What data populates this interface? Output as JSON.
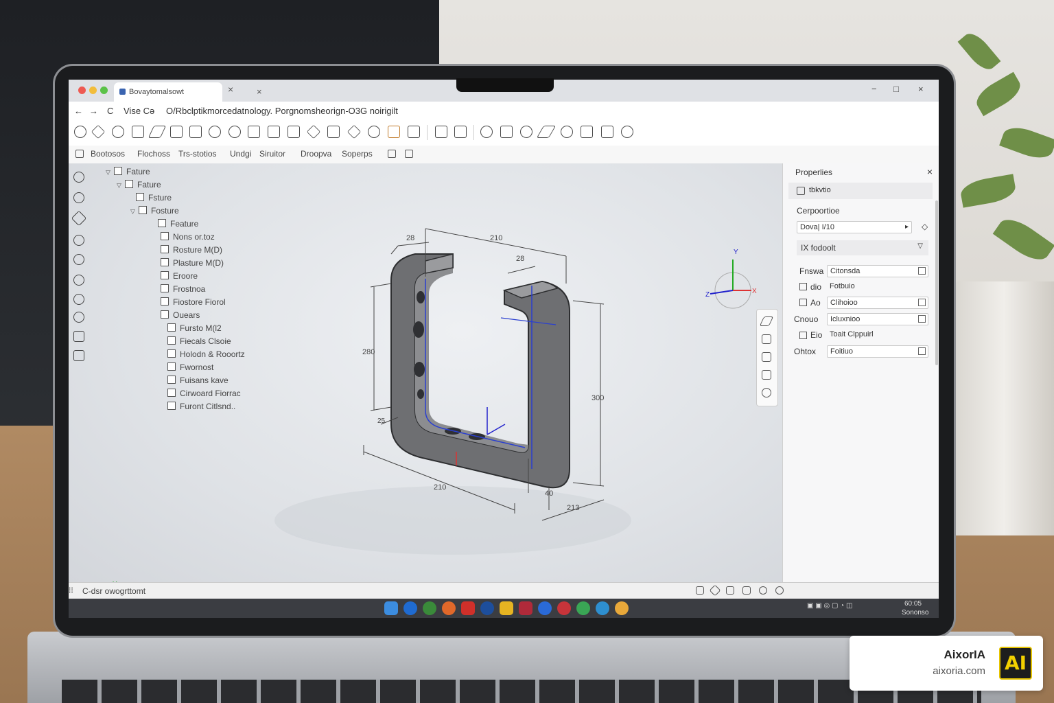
{
  "browser": {
    "tab_title": "Bovaytomalsowt",
    "tab_close": "×",
    "new_tab": "×",
    "nav_back": "←",
    "nav_forward": "→",
    "nav_reload": "C",
    "address_part1": "Vise  Cə",
    "address_url": "O/Rbclptikmorcedatnology.  Porgnomsheorign-O3G noirigilt",
    "win_min": "−",
    "win_max": "□",
    "win_close": "×"
  },
  "menubar": [
    "Bootosos",
    "Flochoss",
    "Trs-stotios",
    "Undgi",
    "Siruitor",
    "Droopva",
    "Soperps"
  ],
  "tree": [
    {
      "label": "Fature",
      "indent": 0,
      "arrow": "▽"
    },
    {
      "label": "Fature",
      "indent": 1,
      "arrow": "▽"
    },
    {
      "label": "Fsture",
      "indent": 2,
      "arrow": ""
    },
    {
      "label": "Fosture",
      "indent": 1,
      "arrow": "▽"
    },
    {
      "label": "Feature",
      "indent": 3,
      "arrow": ""
    },
    {
      "label": "Nons or.toz",
      "indent": 4,
      "arrow": ""
    },
    {
      "label": "Rosture M(D)",
      "indent": 4,
      "arrow": ""
    },
    {
      "label": "Plasture M(D)",
      "indent": 4,
      "arrow": ""
    },
    {
      "label": "Eroore",
      "indent": 4,
      "arrow": ""
    },
    {
      "label": "Frostnoa",
      "indent": 4,
      "arrow": ""
    },
    {
      "label": "Fiostore Fiorol",
      "indent": 4,
      "arrow": ""
    },
    {
      "label": "Ouears",
      "indent": 4,
      "arrow": ""
    },
    {
      "label": "Fursto M(l2",
      "indent": 5,
      "arrow": ""
    },
    {
      "label": "Fiecals Clsoie",
      "indent": 5,
      "arrow": ""
    },
    {
      "label": "Holodn & Rooortz",
      "indent": 5,
      "arrow": ""
    },
    {
      "label": "Fwornost",
      "indent": 5,
      "arrow": ""
    },
    {
      "label": "Fuisans kave",
      "indent": 5,
      "arrow": ""
    },
    {
      "label": "Cirwoard Fiorrac",
      "indent": 5,
      "arrow": ""
    },
    {
      "label": "Furont Citlsnd..",
      "indent": 5,
      "arrow": ""
    }
  ],
  "dimensions": {
    "d_top_left": "28",
    "d_top_mid": "210",
    "d_top_right": "28",
    "d_left": "280",
    "d_right": "300",
    "d_bottom": "210",
    "d_bottom_small": "40",
    "d_depth": "213",
    "d_corner": "25"
  },
  "triad": {
    "y": "Y",
    "x": "X",
    "z": "Z"
  },
  "axis_small": {
    "y": "Y",
    "x": "X",
    "z": "Z"
  },
  "properties": {
    "title": "Properlies",
    "close": "×",
    "section1": "tbkvtio",
    "section2": "Cerpoortioe",
    "select1": "Dova| I/10",
    "group": "IX  fodoolt",
    "rows": [
      {
        "label": "Fnswa",
        "value": "Citonsda"
      },
      {
        "label": "dio",
        "value": "Fotbuio"
      },
      {
        "label": "Ao",
        "value": "Clihoioo"
      },
      {
        "label": "Cnouo",
        "value": "Icluxnioo"
      },
      {
        "label": "Eio",
        "value": "Toait Clppuirl"
      },
      {
        "label": "Ohtox",
        "value": "Foitiuo"
      }
    ]
  },
  "status": {
    "text": "C-dsr owogrttomt"
  },
  "tray": {
    "time": "60:05",
    "date": "Sononso"
  },
  "watermark": {
    "name": "AixorIA",
    "url": "aixoria.com",
    "logo": "AI"
  },
  "colors": {
    "accent": "#3a64b0",
    "axis_x": "#d33",
    "axis_y": "#2a2",
    "axis_z": "#22c",
    "part": "#6e6f72"
  }
}
